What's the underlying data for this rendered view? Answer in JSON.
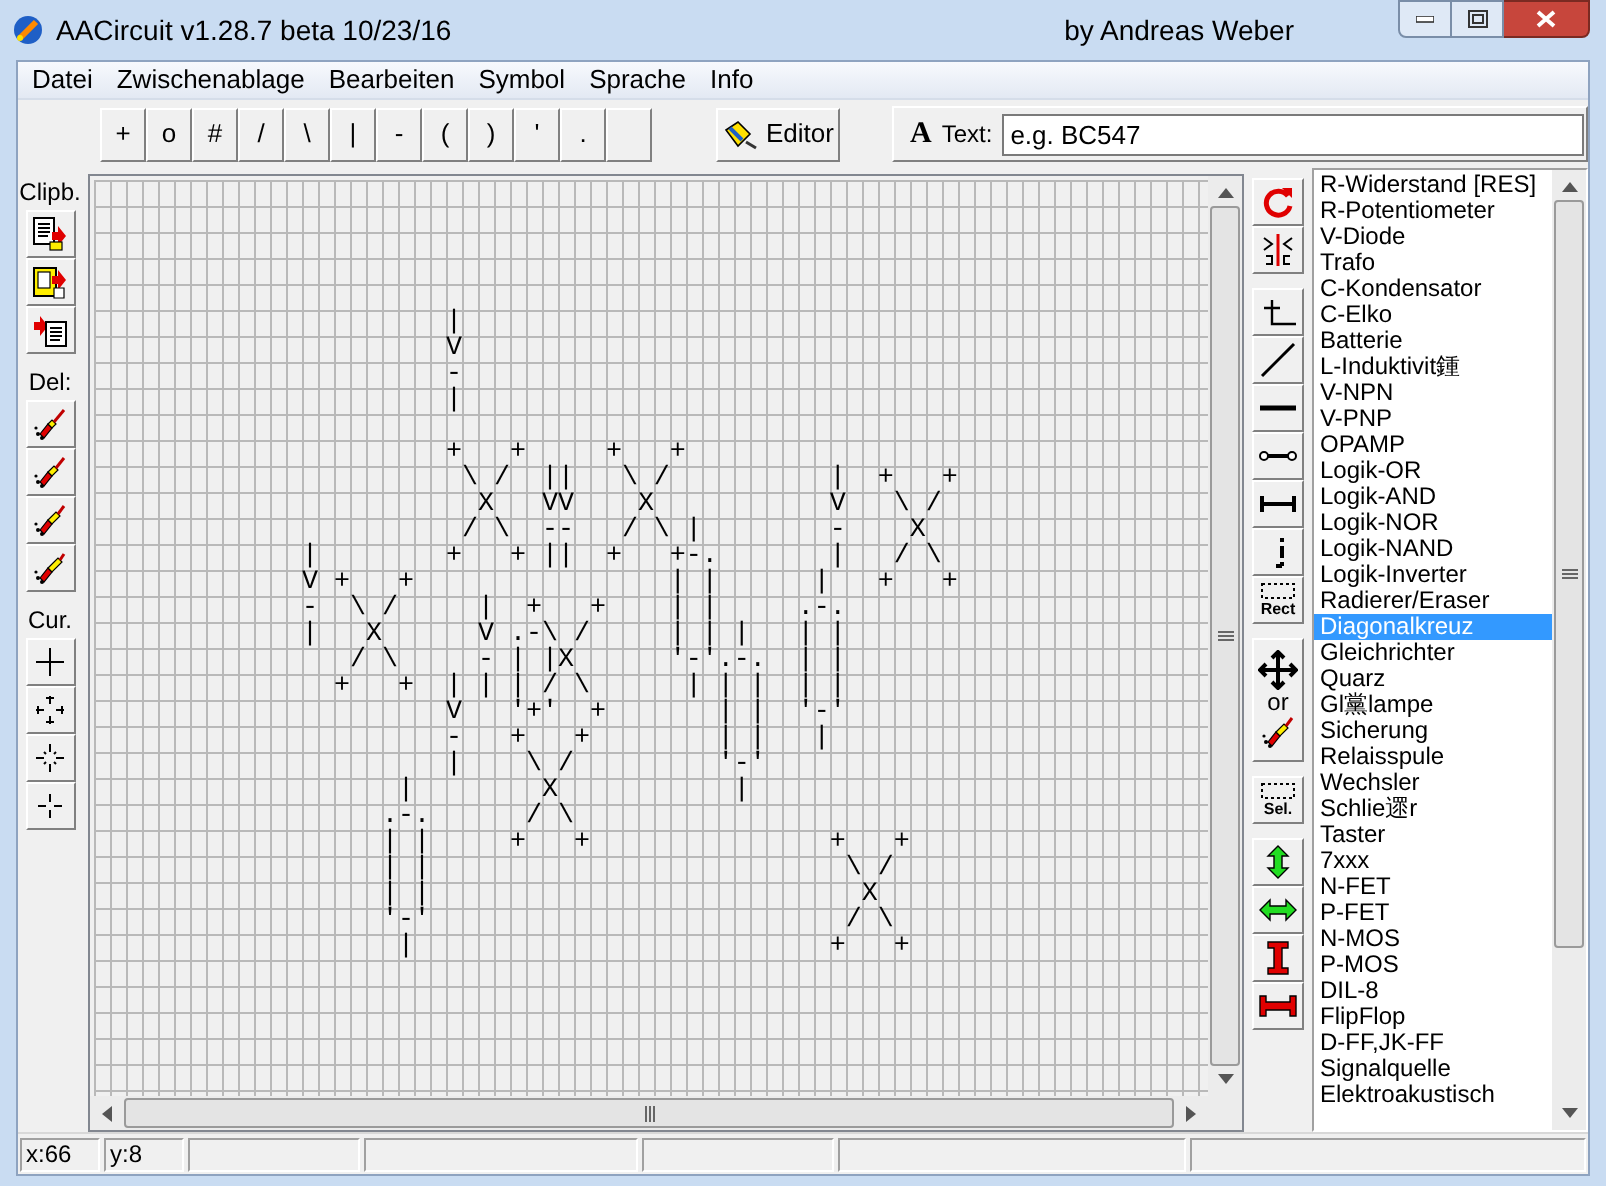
{
  "window": {
    "title": "AACircuit v1.28.7 beta 10/23/16",
    "author": "by Andreas Weber"
  },
  "menu": [
    {
      "label": "Datei"
    },
    {
      "label": "Zwischenablage"
    },
    {
      "label": "Bearbeiten"
    },
    {
      "label": "Symbol"
    },
    {
      "label": "Sprache"
    },
    {
      "label": "Info"
    }
  ],
  "toolbar": {
    "char_buttons": [
      "+",
      "o",
      "#",
      "/",
      "\\",
      "|",
      "-",
      "(",
      ")",
      "'",
      "."
    ],
    "editor": "Editor",
    "text_icon": "A",
    "text_label": "Text:",
    "text_value": "e.g. BC547"
  },
  "left_panel": [
    {
      "label": "Clipb.",
      "tools": [
        {
          "kind": "copy"
        },
        {
          "kind": "cut"
        },
        {
          "kind": "paste"
        }
      ]
    },
    {
      "label": "Del:",
      "tools": [
        {
          "kind": "erase-xs"
        },
        {
          "kind": "erase-s"
        },
        {
          "kind": "erase-m"
        },
        {
          "kind": "erase-l"
        }
      ]
    },
    {
      "label": "Cur.",
      "tools": [
        {
          "kind": "cross"
        },
        {
          "kind": "cross-gap"
        },
        {
          "kind": "cross-wide"
        },
        {
          "kind": "cross-dotted"
        }
      ]
    }
  ],
  "tool_groups": [
    [
      {
        "kind": "rotate"
      },
      {
        "kind": "mirror"
      }
    ],
    [
      {
        "kind": "corner-line"
      },
      {
        "kind": "diagonal-line"
      },
      {
        "kind": "horizontal-line"
      },
      {
        "kind": "terminal-line"
      },
      {
        "kind": "double-arrow"
      },
      {
        "kind": "dotted-line"
      },
      {
        "kind": "rect",
        "label": "Rect"
      }
    ],
    [
      {
        "kind": "move-or-erase",
        "label": "or"
      }
    ],
    [
      {
        "kind": "select",
        "label": "Sel."
      }
    ],
    [
      {
        "kind": "stretch-vertical"
      },
      {
        "kind": "stretch-horizontal"
      },
      {
        "kind": "ibeam-vertical"
      },
      {
        "kind": "ibeam-horizontal"
      }
    ]
  ],
  "canvas": {
    "schematic": "                      |\n                      V\n                      -\n                      |\n\n                      +   +     +   +\n                       \\ /  ||   \\ /          |  +   +\n                        X   VV    X           V   \\ /\n                       / \\  --   / \\ |        -    X\n             |        +   + ||  +   +-.       |   / \\\n             V +   +                | |      |   +   +\n             -  \\ /     |  +   +    | |     .-.\n             |   X      V .-\\ /     | | |   | |\n                / \\     - | |X      '-'.-.  | |\n               +   +  | | | / \\      | | |  | |\n                      V   '+'  +       | |  '-'\n                      -   +   +        | |   |\n                      |    \\ /         '-'\n                   |        X           |\n                  .-.      / \\\n                  | |     +   +               +   +\n                  | |                          \\ /\n                  | |                           X\n                  '-'                          / \\\n                   |                          +   +"
  },
  "symbol_list": [
    {
      "label": "R-Widerstand [RES]",
      "selected": false
    },
    {
      "label": "R-Potentiometer",
      "selected": false
    },
    {
      "label": "V-Diode",
      "selected": false
    },
    {
      "label": "Trafo",
      "selected": false
    },
    {
      "label": "C-Kondensator",
      "selected": false
    },
    {
      "label": "C-Elko",
      "selected": false
    },
    {
      "label": "Batterie",
      "selected": false
    },
    {
      "label": "L-Induktivit鍾",
      "selected": false
    },
    {
      "label": "V-NPN",
      "selected": false
    },
    {
      "label": "V-PNP",
      "selected": false
    },
    {
      "label": "OPAMP",
      "selected": false
    },
    {
      "label": "Logik-OR",
      "selected": false
    },
    {
      "label": "Logik-AND",
      "selected": false
    },
    {
      "label": "Logik-NOR",
      "selected": false
    },
    {
      "label": "Logik-NAND",
      "selected": false
    },
    {
      "label": "Logik-Inverter",
      "selected": false
    },
    {
      "label": "Radierer/Eraser",
      "selected": false
    },
    {
      "label": "Diagonalkreuz",
      "selected": true
    },
    {
      "label": "Gleichrichter",
      "selected": false
    },
    {
      "label": "Quarz",
      "selected": false
    },
    {
      "label": "Gl黨lampe",
      "selected": false
    },
    {
      "label": "Sicherung",
      "selected": false
    },
    {
      "label": "Relaisspule",
      "selected": false
    },
    {
      "label": "Wechsler",
      "selected": false
    },
    {
      "label": "Schlie遝r",
      "selected": false
    },
    {
      "label": "Taster",
      "selected": false
    },
    {
      "label": "7xxx",
      "selected": false
    },
    {
      "label": "N-FET",
      "selected": false
    },
    {
      "label": "P-FET",
      "selected": false
    },
    {
      "label": "N-MOS",
      "selected": false
    },
    {
      "label": "P-MOS",
      "selected": false
    },
    {
      "label": "DIL-8",
      "selected": false
    },
    {
      "label": "FlipFlop",
      "selected": false
    },
    {
      "label": "D-FF,JK-FF",
      "selected": false
    },
    {
      "label": "Signalquelle",
      "selected": false
    },
    {
      "label": "Elektroakustisch",
      "selected": false
    }
  ],
  "status_bar": [
    "x:66",
    "y:8"
  ]
}
